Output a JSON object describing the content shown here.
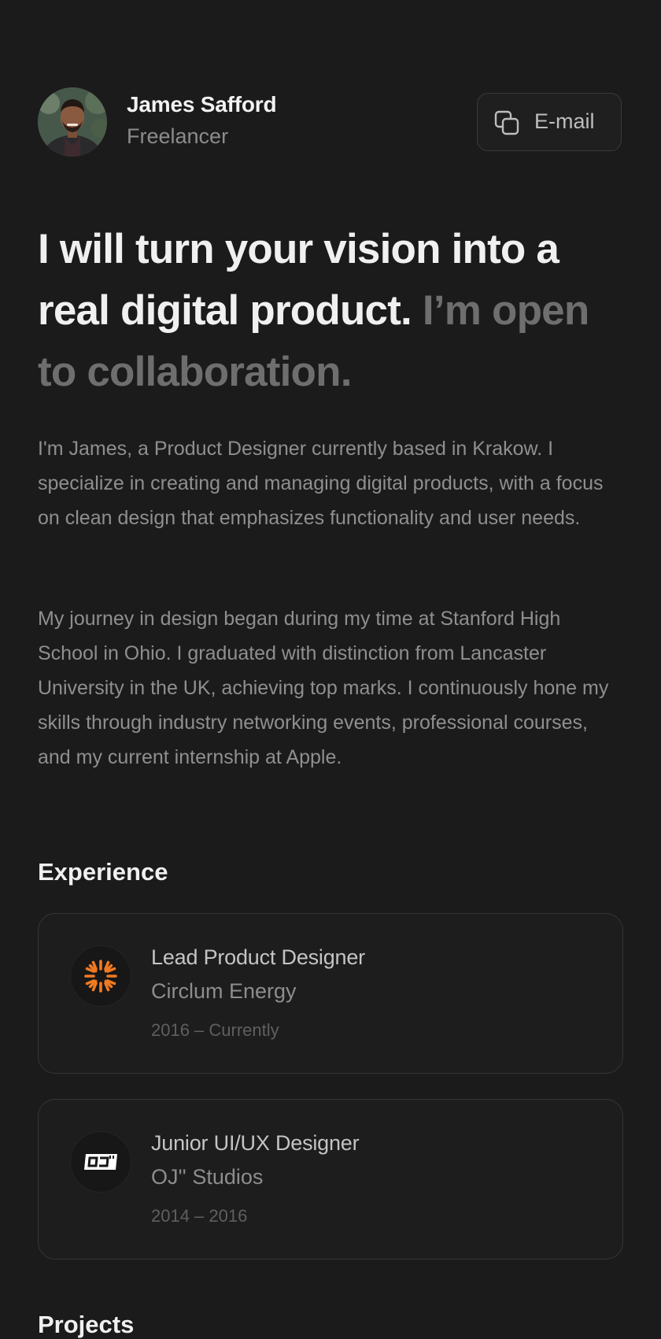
{
  "profile": {
    "name": "James Safford",
    "role": "Freelancer",
    "email_label": "E-mail"
  },
  "headline": {
    "strong": "I will turn your vision into a real digital product.",
    "muted": "I’m open to collaboration."
  },
  "about": {
    "paragraph_1": "I'm James, a Product Designer currently based in Krakow. I specialize in creating and managing digital products, with a focus on clean design that emphasizes functionality and user needs.",
    "paragraph_2": "My journey in design began during my time at Stanford High School in Ohio. I graduated with distinction from Lancaster University in the UK, achieving top marks. I continuously hone my skills through industry networking events, professional courses, and my current internship at Apple."
  },
  "experience": {
    "title": "Experience",
    "items": [
      {
        "title": "Lead Product Designer",
        "company": "Circlum Energy",
        "dates": "2016 – Currently",
        "logo": "circlum-sun-icon",
        "logo_color": "#f07a22"
      },
      {
        "title": "Junior UI/UX Designer",
        "company": "OJ'' Studios",
        "dates": "2014 – 2016",
        "logo": "oj-studios-logo",
        "logo_color": "#ffffff"
      }
    ]
  },
  "projects": {
    "title": "Projects"
  },
  "colors": {
    "background": "#1b1b1b",
    "text_primary": "#f0f0f0",
    "text_muted": "#8f8f8f",
    "accent_orange": "#f07a22"
  }
}
